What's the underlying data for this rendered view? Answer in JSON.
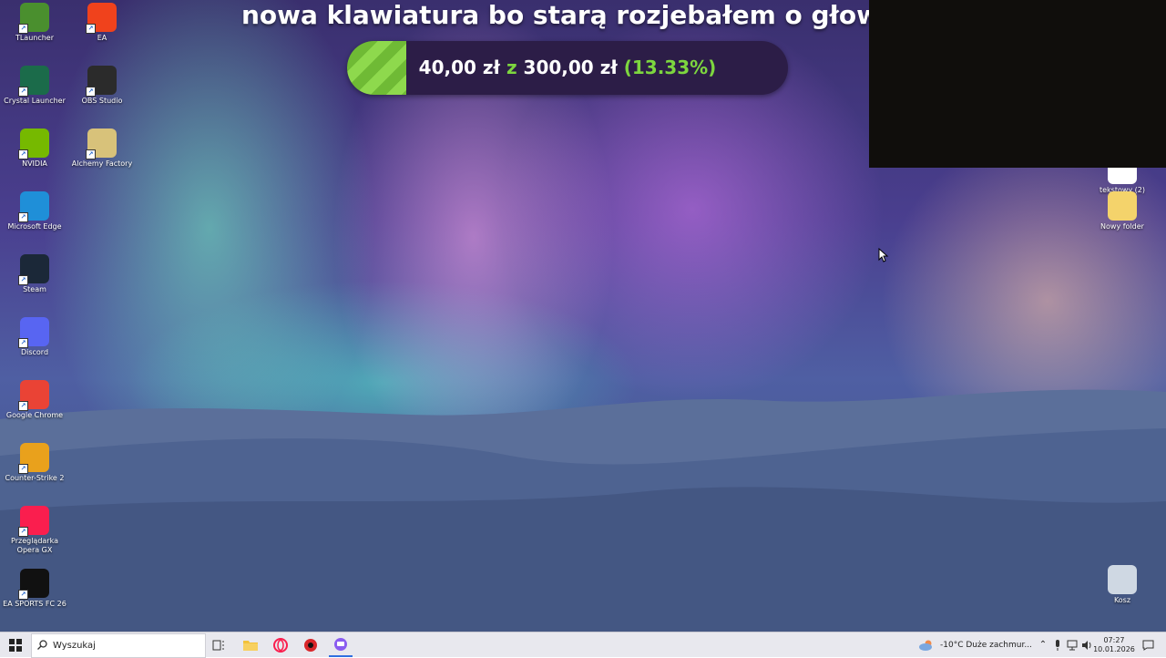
{
  "desktop_icons": [
    {
      "label": "TLauncher",
      "icon": "tlauncher-icon",
      "color": "#4a8f2e"
    },
    {
      "label": "EA",
      "icon": "ea-icon",
      "color": "#f0421c"
    },
    {
      "label": "Crystal Launcher",
      "icon": "crystal-launcher-icon",
      "color": "#1b6b4a"
    },
    {
      "label": "OBS Studio",
      "icon": "obs-icon",
      "color": "#2b2b2b"
    },
    {
      "label": "NVIDIA",
      "icon": "nvidia-icon",
      "color": "#76b900"
    },
    {
      "label": "Alchemy Factory",
      "icon": "alchemy-factory-icon",
      "color": "#d8c27a"
    },
    {
      "label": "Microsoft Edge",
      "icon": "edge-icon",
      "color": "#1f8fd8"
    },
    {
      "label": "Steam",
      "icon": "steam-icon",
      "color": "#1b2838"
    },
    {
      "label": "Discord",
      "icon": "discord-icon",
      "color": "#5865f2"
    },
    {
      "label": "Google Chrome",
      "icon": "chrome-icon",
      "color": "#ea4335"
    },
    {
      "label": "Counter-Strike 2",
      "icon": "counter-strike-icon",
      "color": "#e9a11c"
    },
    {
      "label": "Przeglądarka Opera GX",
      "icon": "opera-gx-icon",
      "color": "#fa1e4e"
    },
    {
      "label": "EA SPORTS FC 26",
      "icon": "ea-sports-fc-icon",
      "color": "#111111"
    },
    {
      "label": "tekstowy (2)",
      "icon": "text-file-icon",
      "color": "#ffffff"
    },
    {
      "label": "Nowy folder",
      "icon": "folder-icon",
      "color": "#f4d36b"
    },
    {
      "label": "Kosz",
      "icon": "recycle-bin-icon",
      "color": "#cfd8e3"
    }
  ],
  "donation": {
    "title": "nowa klawiatura bo starą rozjebałem o głowe",
    "current": "40,00 zł",
    "separator": "z",
    "goal": "300,00 zł",
    "percent_text": "(13.33%)",
    "progress_fraction": 0.1333,
    "bar_color": "#7dd63f",
    "bg_color": "#2c1d47"
  },
  "taskbar": {
    "search_placeholder": "Wyszukaj",
    "weather": "-10°C  Duże zachmur...",
    "time": "07:27",
    "date": "10.01.2026"
  }
}
